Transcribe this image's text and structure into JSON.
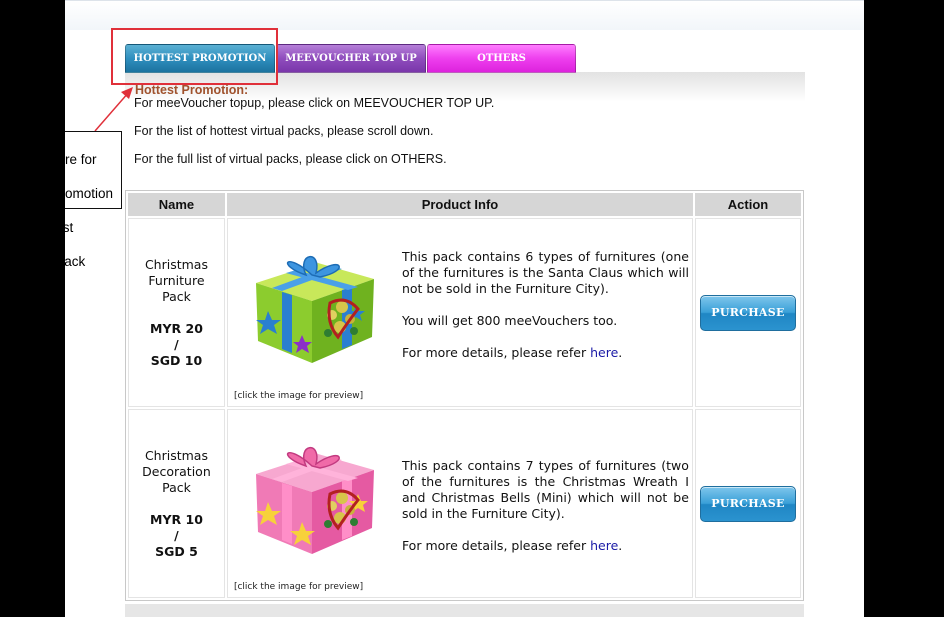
{
  "tabs": [
    {
      "label": "HOTTEST PROMOTION",
      "color": "#2f8fbf"
    },
    {
      "label": "MEEVOUCHER TOP UP",
      "color": "#8f4dbd"
    },
    {
      "label": "OTHERS",
      "color": "#ee3fee"
    }
  ],
  "section": {
    "title": "Hottest Promotion:",
    "lines": [
      "For meeVoucher topup, please click on MEEVOUCHER TOP UP.",
      "For the list of hottest virtual packs, please scroll down.",
      "For the full list of virtual packs, please click on OTHERS."
    ]
  },
  "callout": {
    "text": "Click here for latest promotion or hottest virtual pack",
    "line1": "Click here for",
    "line2": "latest promotion",
    "line3": "or hottest",
    "line4": "virtual pack"
  },
  "table": {
    "headers": [
      "Name",
      "Product Info",
      "Action"
    ],
    "rows": [
      {
        "name": [
          "Christmas",
          "Furniture",
          "Pack"
        ],
        "price": [
          "MYR 20",
          "/",
          "SGD 10"
        ],
        "gift_color": "green",
        "description": "This pack contains 6 types of furnitures (one of the furnitures is the Santa Claus which will not be sold in the Furniture City).",
        "extra": "You will get 800 meeVouchers too.",
        "details_prefix": "For more details, please refer ",
        "details_link": "here",
        "details_suffix": ".",
        "preview_note": "[click the image for preview]",
        "action": "PURCHASE"
      },
      {
        "name": [
          "Christmas",
          "Decoration",
          "Pack"
        ],
        "price": [
          "MYR 10",
          "/",
          "SGD 5"
        ],
        "gift_color": "pink",
        "description": "This pack contains 7 types of furnitures (two of the furnitures is the Christmas Wreath I and Christmas Bells (Mini) which will not be sold in the Furniture City).",
        "extra": "",
        "details_prefix": "For more details, please refer ",
        "details_link": "here",
        "details_suffix": ".",
        "preview_note": "[click the image for preview]",
        "action": "PURCHASE"
      }
    ]
  },
  "colors": {
    "section_title": "#a0522d",
    "highlight_box": "#e0303a",
    "link": "#1a1aa6"
  }
}
